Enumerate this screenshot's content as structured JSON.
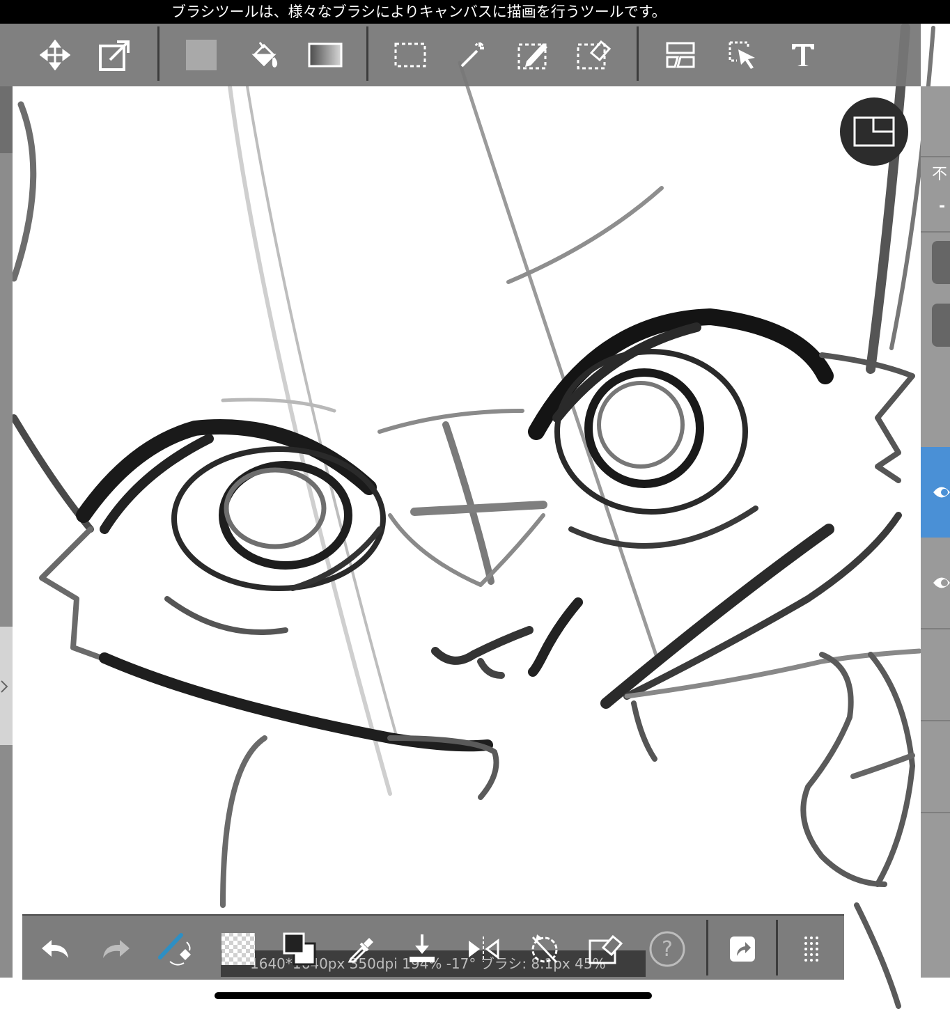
{
  "tooltip": {
    "text": "ブラシツールは、様々なブラシによりキャンバスに描画を行うツールです。"
  },
  "top_toolbar": {
    "tools": [
      {
        "name": "move-icon"
      },
      {
        "name": "transform-icon"
      },
      {
        "name": "fill-color-icon"
      },
      {
        "name": "bucket-icon"
      },
      {
        "name": "gradient-icon"
      },
      {
        "name": "select-rect-icon"
      },
      {
        "name": "magic-wand-icon"
      },
      {
        "name": "select-pen-icon"
      },
      {
        "name": "select-eraser-icon"
      },
      {
        "name": "frame-divide-icon"
      },
      {
        "name": "operation-icon"
      },
      {
        "name": "text-icon"
      }
    ]
  },
  "right_panel": {
    "opacity_label": "不",
    "minus_label": "-"
  },
  "bottom_toolbar": {
    "status": "1640*1640px 350dpi 194% -17° ブラシ: 8.1px 45%",
    "help_label": "?"
  },
  "colors": {
    "toolbar": "#767676",
    "selected_layer": "#4a90d6",
    "float_button": "#2c2c2c"
  }
}
